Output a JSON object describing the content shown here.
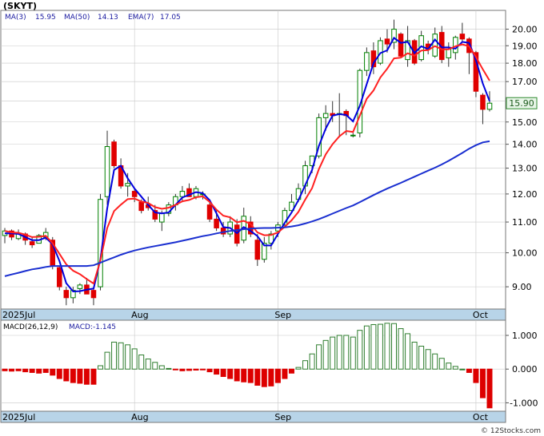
{
  "ticker_label": "(SKYT)",
  "legend": {
    "ma3": "MA(3)",
    "ma3_val": "15.95",
    "ma50": "MA(50)",
    "ma50_val": "14.13",
    "ema7": "EMA(7)",
    "ema7_val": "17.05"
  },
  "macd_legend": {
    "label": "MACD(26,12,9)",
    "value_label": "MACD:-1.145"
  },
  "last_price_badge": "15.90",
  "watermark": "© 12Stocks.com",
  "colors": {
    "up": "#008000",
    "down": "#e00000",
    "ma3": "#0000dd",
    "ema7": "#ff2020",
    "ma50": "#1a2fd0",
    "axis_band": "#b8d4e8",
    "macd_up": "#2e7d2e",
    "macd_down": "#dd0000"
  },
  "chart_data": [
    {
      "type": "candlestick",
      "title": "(SKYT)",
      "y_scale": "log",
      "ylim": [
        8.4,
        21.2
      ],
      "y_ticks": [
        9.0,
        10.0,
        11.0,
        12.0,
        13.0,
        14.0,
        15.0,
        16.0,
        17.0,
        18.0,
        19.0,
        20.0
      ],
      "y_tick_labels": [
        "9.00",
        "10.00",
        "11.00",
        "12.00",
        "13.00",
        "14.00",
        "15.00",
        "16.00",
        "17.00",
        "18.00",
        "19.00",
        "20.00"
      ],
      "x_labels": [
        {
          "label": "2025Jul",
          "index": 0
        },
        {
          "label": "Aug",
          "index": 19
        },
        {
          "label": "Sep",
          "index": 40
        },
        {
          "label": "Oct",
          "index": 69
        }
      ],
      "ohlc": [
        [
          10.55,
          10.8,
          10.3,
          10.7
        ],
        [
          10.7,
          10.75,
          10.4,
          10.5
        ],
        [
          10.45,
          10.75,
          10.4,
          10.6
        ],
        [
          10.6,
          10.65,
          10.25,
          10.4
        ],
        [
          10.35,
          10.5,
          10.15,
          10.25
        ],
        [
          10.3,
          10.6,
          10.3,
          10.55
        ],
        [
          10.5,
          10.8,
          10.4,
          10.65
        ],
        [
          10.4,
          10.5,
          9.5,
          9.6
        ],
        [
          9.55,
          9.6,
          8.9,
          9.0
        ],
        [
          8.9,
          9.0,
          8.5,
          8.7
        ],
        [
          8.7,
          9.0,
          8.55,
          8.9
        ],
        [
          8.95,
          9.1,
          8.8,
          9.05
        ],
        [
          9.05,
          9.25,
          8.9,
          8.8
        ],
        [
          8.9,
          8.95,
          8.5,
          8.7
        ],
        [
          9.0,
          12.0,
          8.9,
          11.8
        ],
        [
          11.9,
          14.6,
          11.6,
          13.9
        ],
        [
          14.1,
          14.2,
          13.0,
          13.1
        ],
        [
          13.1,
          13.4,
          12.2,
          12.3
        ],
        [
          12.3,
          12.8,
          11.9,
          12.4
        ],
        [
          12.1,
          12.2,
          11.7,
          11.9
        ],
        [
          11.7,
          11.8,
          11.3,
          11.4
        ],
        [
          11.6,
          11.9,
          11.4,
          11.5
        ],
        [
          11.4,
          11.6,
          11.0,
          11.1
        ],
        [
          11.0,
          11.4,
          10.7,
          11.3
        ],
        [
          11.3,
          11.7,
          11.2,
          11.6
        ],
        [
          11.6,
          12.0,
          11.4,
          11.9
        ],
        [
          11.9,
          12.3,
          11.7,
          12.1
        ],
        [
          12.2,
          12.4,
          11.9,
          11.9
        ],
        [
          11.9,
          12.3,
          11.8,
          12.2
        ],
        [
          12.0,
          12.1,
          11.8,
          12.0
        ],
        [
          11.6,
          11.8,
          11.0,
          11.1
        ],
        [
          11.1,
          11.4,
          10.7,
          10.8
        ],
        [
          10.8,
          11.0,
          10.5,
          10.6
        ],
        [
          10.6,
          11.2,
          10.5,
          11.0
        ],
        [
          10.9,
          11.1,
          10.2,
          10.3
        ],
        [
          10.4,
          11.5,
          10.3,
          11.2
        ],
        [
          11.0,
          11.2,
          10.5,
          10.6
        ],
        [
          10.4,
          10.6,
          9.6,
          9.8
        ],
        [
          9.8,
          10.5,
          9.7,
          10.3
        ],
        [
          10.3,
          10.7,
          10.1,
          10.6
        ],
        [
          10.7,
          11.0,
          10.5,
          10.9
        ],
        [
          10.9,
          11.5,
          10.8,
          11.4
        ],
        [
          11.4,
          12.0,
          11.3,
          11.7
        ],
        [
          11.8,
          12.4,
          11.7,
          12.2
        ],
        [
          12.3,
          13.3,
          12.0,
          13.1
        ],
        [
          13.1,
          13.5,
          12.8,
          13.5
        ],
        [
          13.5,
          15.4,
          13.4,
          15.2
        ],
        [
          15.2,
          15.8,
          14.6,
          15.4
        ],
        [
          15.4,
          16.0,
          15.0,
          15.3
        ],
        [
          15.4,
          16.4,
          14.3,
          15.4
        ],
        [
          15.5,
          15.6,
          14.4,
          15.3
        ],
        [
          14.4,
          14.5,
          14.3,
          14.4
        ],
        [
          14.5,
          17.7,
          14.3,
          17.6
        ],
        [
          17.6,
          18.9,
          17.3,
          18.6
        ],
        [
          18.7,
          19.2,
          17.4,
          17.8
        ],
        [
          18.0,
          19.5,
          17.9,
          19.3
        ],
        [
          19.4,
          20.0,
          18.6,
          19.1
        ],
        [
          19.2,
          20.6,
          18.8,
          20.0
        ],
        [
          19.7,
          19.8,
          18.3,
          18.4
        ],
        [
          18.2,
          20.2,
          17.8,
          19.3
        ],
        [
          19.3,
          19.4,
          17.9,
          18.0
        ],
        [
          18.2,
          19.9,
          18.1,
          19.6
        ],
        [
          19.1,
          19.3,
          18.5,
          18.8
        ],
        [
          18.4,
          20.1,
          18.3,
          19.7
        ],
        [
          19.8,
          20.2,
          18.0,
          18.2
        ],
        [
          18.3,
          19.2,
          17.8,
          18.8
        ],
        [
          18.6,
          19.6,
          18.2,
          19.5
        ],
        [
          19.7,
          20.4,
          19.2,
          19.4
        ],
        [
          19.4,
          19.5,
          17.4,
          18.6
        ],
        [
          18.6,
          18.7,
          16.2,
          16.5
        ],
        [
          16.3,
          16.4,
          14.9,
          15.6
        ],
        [
          15.6,
          16.5,
          15.5,
          15.9
        ]
      ],
      "series": [
        {
          "name": "MA(3)",
          "values": [
            10.62,
            10.62,
            10.6,
            10.5,
            10.4,
            10.4,
            10.48,
            10.27,
            9.75,
            9.1,
            8.87,
            8.88,
            8.92,
            8.95,
            9.8,
            11.47,
            12.93,
            13.1,
            12.6,
            12.2,
            11.9,
            11.6,
            11.33,
            11.3,
            11.33,
            11.6,
            11.87,
            11.97,
            12.07,
            12.03,
            11.77,
            11.3,
            10.83,
            10.8,
            10.63,
            10.83,
            10.7,
            10.53,
            10.23,
            10.23,
            10.6,
            10.97,
            11.33,
            11.77,
            12.33,
            12.93,
            13.93,
            14.7,
            15.3,
            15.37,
            15.33,
            15.03,
            15.77,
            16.87,
            18.0,
            18.57,
            18.73,
            19.47,
            19.17,
            19.23,
            18.57,
            18.97,
            18.8,
            19.37,
            18.9,
            18.9,
            18.83,
            19.23,
            19.17,
            18.17,
            16.9,
            16.0
          ]
        },
        {
          "name": "EMA(7)",
          "values": [
            10.7,
            10.65,
            10.64,
            10.58,
            10.5,
            10.51,
            10.54,
            10.3,
            9.97,
            9.65,
            9.46,
            9.36,
            9.22,
            9.09,
            9.77,
            10.8,
            11.38,
            11.61,
            11.81,
            11.83,
            11.72,
            11.67,
            11.52,
            11.46,
            11.5,
            11.6,
            11.73,
            11.78,
            11.88,
            11.91,
            11.71,
            11.43,
            11.22,
            11.16,
            10.99,
            11.04,
            10.93,
            10.65,
            10.56,
            10.57,
            10.65,
            10.84,
            11.06,
            11.35,
            11.79,
            12.22,
            12.96,
            13.57,
            14.0,
            14.35,
            14.59,
            14.54,
            15.3,
            16.12,
            16.54,
            17.22,
            17.69,
            18.27,
            18.31,
            18.56,
            18.42,
            18.72,
            18.74,
            18.98,
            18.79,
            18.79,
            18.97,
            19.08,
            18.96,
            18.35,
            17.66,
            17.05
          ]
        },
        {
          "name": "MA(50)",
          "values": [
            9.3,
            9.35,
            9.4,
            9.45,
            9.5,
            9.53,
            9.57,
            9.6,
            9.6,
            9.6,
            9.6,
            9.6,
            9.6,
            9.62,
            9.7,
            9.78,
            9.86,
            9.94,
            10.01,
            10.07,
            10.12,
            10.17,
            10.21,
            10.25,
            10.29,
            10.33,
            10.38,
            10.43,
            10.48,
            10.53,
            10.57,
            10.62,
            10.66,
            10.7,
            10.73,
            10.76,
            10.78,
            10.79,
            10.8,
            10.8,
            10.81,
            10.82,
            10.85,
            10.89,
            10.95,
            11.02,
            11.1,
            11.19,
            11.29,
            11.39,
            11.49,
            11.58,
            11.7,
            11.83,
            11.96,
            12.08,
            12.2,
            12.31,
            12.42,
            12.54,
            12.66,
            12.78,
            12.9,
            13.02,
            13.15,
            13.3,
            13.46,
            13.63,
            13.81,
            13.96,
            14.08,
            14.13
          ]
        }
      ]
    },
    {
      "type": "bar",
      "title": "MACD(26,12,9)",
      "ylim": [
        -1.25,
        1.45
      ],
      "y_ticks": [
        -1.0,
        0.0,
        1.0
      ],
      "y_tick_labels": [
        "-1.000",
        "0.000",
        "1.000"
      ],
      "x_labels": [
        {
          "label": "2025Jul",
          "index": 0
        },
        {
          "label": "Aug",
          "index": 19
        },
        {
          "label": "Sep",
          "index": 40
        },
        {
          "label": "Oct",
          "index": 69
        }
      ],
      "values": [
        -0.05,
        -0.06,
        -0.05,
        -0.08,
        -0.1,
        -0.12,
        -0.1,
        -0.18,
        -0.28,
        -0.35,
        -0.4,
        -0.42,
        -0.45,
        -0.45,
        0.1,
        0.5,
        0.8,
        0.78,
        0.72,
        0.6,
        0.42,
        0.3,
        0.2,
        0.1,
        0.02,
        -0.02,
        -0.05,
        -0.04,
        -0.03,
        -0.02,
        -0.08,
        -0.15,
        -0.22,
        -0.28,
        -0.35,
        -0.38,
        -0.4,
        -0.48,
        -0.52,
        -0.5,
        -0.4,
        -0.28,
        -0.12,
        0.05,
        0.25,
        0.45,
        0.72,
        0.85,
        0.95,
        1.0,
        1.0,
        0.95,
        1.15,
        1.28,
        1.32,
        1.33,
        1.36,
        1.35,
        1.2,
        1.05,
        0.8,
        0.68,
        0.58,
        0.45,
        0.32,
        0.18,
        0.08,
        0.0,
        -0.1,
        -0.4,
        -0.85,
        -1.15
      ]
    }
  ]
}
